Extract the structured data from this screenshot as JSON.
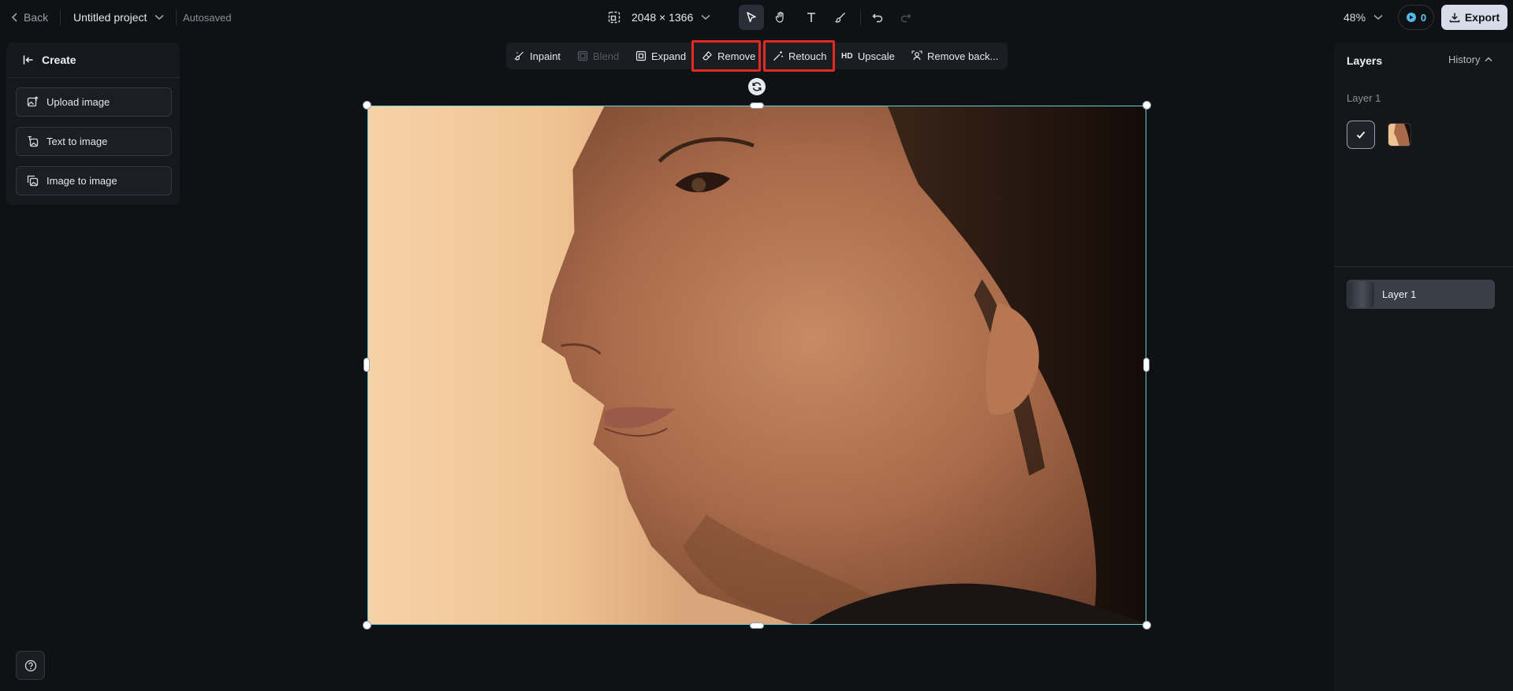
{
  "topbar": {
    "back_label": "Back",
    "project_name": "Untitled project",
    "autosaved_label": "Autosaved",
    "canvas_size": "2048 × 1366",
    "zoom": "48%",
    "credits": "0",
    "export_label": "Export"
  },
  "tools": {
    "select": "cursor-arrow-icon",
    "pan": "hand-icon",
    "text": "text-icon",
    "brush": "brush-icon",
    "undo": "undo-icon",
    "redo": "redo-icon"
  },
  "create_panel": {
    "title": "Create",
    "buttons": [
      {
        "label": "Upload image",
        "icon": "upload-image-icon"
      },
      {
        "label": "Text to image",
        "icon": "text-to-image-icon"
      },
      {
        "label": "Image to image",
        "icon": "image-to-image-icon"
      }
    ]
  },
  "context_toolbar": {
    "inpaint": "Inpaint",
    "blend": "Blend",
    "expand": "Expand",
    "remove": "Remove",
    "retouch": "Retouch",
    "upscale_badge": "HD",
    "upscale": "Upscale",
    "remove_background": "Remove back..."
  },
  "highlight_color": "#e02a1f",
  "selection_color": "#5fd4d6",
  "layers_panel": {
    "title": "Layers",
    "history_label": "History",
    "section_label": "Layer 1",
    "layers": [
      {
        "name": "Layer 1"
      }
    ]
  }
}
